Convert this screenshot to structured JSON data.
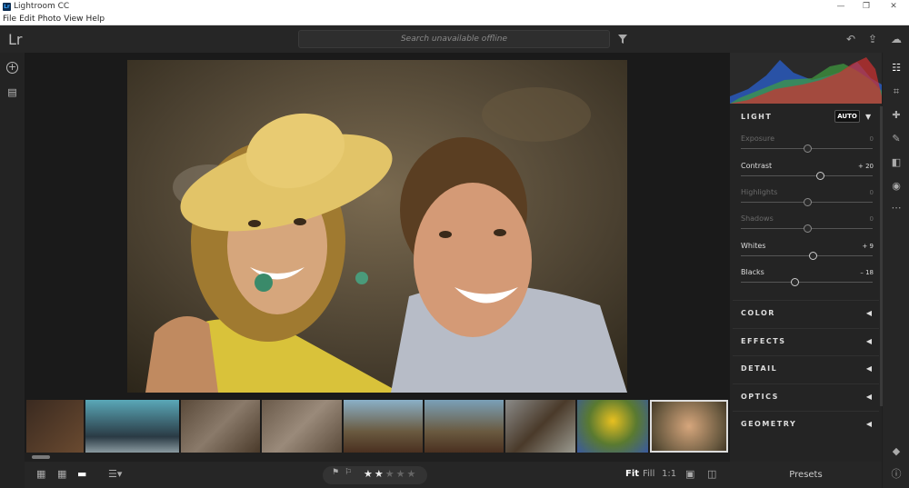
{
  "window": {
    "title": "Lightroom CC",
    "app_icon": "Lr",
    "minimize": "—",
    "maximize": "❐",
    "close": "✕"
  },
  "menu": [
    "File",
    "Edit",
    "Photo",
    "View",
    "Help"
  ],
  "appbar": {
    "logo": "Lr",
    "search_placeholder": "Search unavailable offline"
  },
  "light": {
    "header": "LIGHT",
    "auto_label": "AUTO",
    "sliders": [
      {
        "label": "Exposure",
        "value": "0",
        "level": 0.5,
        "active": false
      },
      {
        "label": "Contrast",
        "value": "+ 20",
        "level": 0.6,
        "active": true
      },
      {
        "label": "Highlights",
        "value": "0",
        "level": 0.5,
        "active": false
      },
      {
        "label": "Shadows",
        "value": "0",
        "level": 0.5,
        "active": false
      },
      {
        "label": "Whites",
        "value": "+ 9",
        "level": 0.545,
        "active": true
      },
      {
        "label": "Blacks",
        "value": "– 18",
        "level": 0.41,
        "active": true
      }
    ]
  },
  "sections": [
    "COLOR",
    "EFFECTS",
    "DETAIL",
    "OPTICS",
    "GEOMETRY"
  ],
  "rating": {
    "stars": 2,
    "max": 5
  },
  "zoom": {
    "fit": "Fit",
    "fill": "Fill",
    "one_to_one": "1:1"
  },
  "presets_label": "Presets",
  "filmstrip_count": 9,
  "colors": {
    "panel": "#242424",
    "bg": "#1a1a1a",
    "accent_red": "#d03030",
    "accent_green": "#40a040",
    "accent_blue": "#2a60d0"
  }
}
